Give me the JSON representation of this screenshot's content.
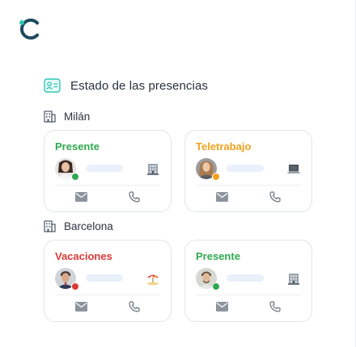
{
  "colors": {
    "brand": "#1e4a5f",
    "accent": "#2fc6b4",
    "present": "#2fa84f",
    "remote": "#f0a21c",
    "vacation": "#d93a36"
  },
  "header": {
    "title": "Estado de las presencias",
    "icon": "id-card-icon"
  },
  "groups": [
    {
      "city": "Milán",
      "icon": "building-icon",
      "cards": [
        {
          "status": "Presente",
          "status_color": "#2fa84f",
          "location_icon": "office-building-icon"
        },
        {
          "status": "Teletrabajo",
          "status_color": "#f0a21c",
          "location_icon": "laptop-icon"
        }
      ]
    },
    {
      "city": "Barcelona",
      "icon": "building-icon",
      "cards": [
        {
          "status": "Vacaciones",
          "status_color": "#d93a36",
          "location_icon": "beach-umbrella-icon"
        },
        {
          "status": "Presente",
          "status_color": "#2fa84f",
          "location_icon": "office-building-icon"
        }
      ]
    }
  ]
}
